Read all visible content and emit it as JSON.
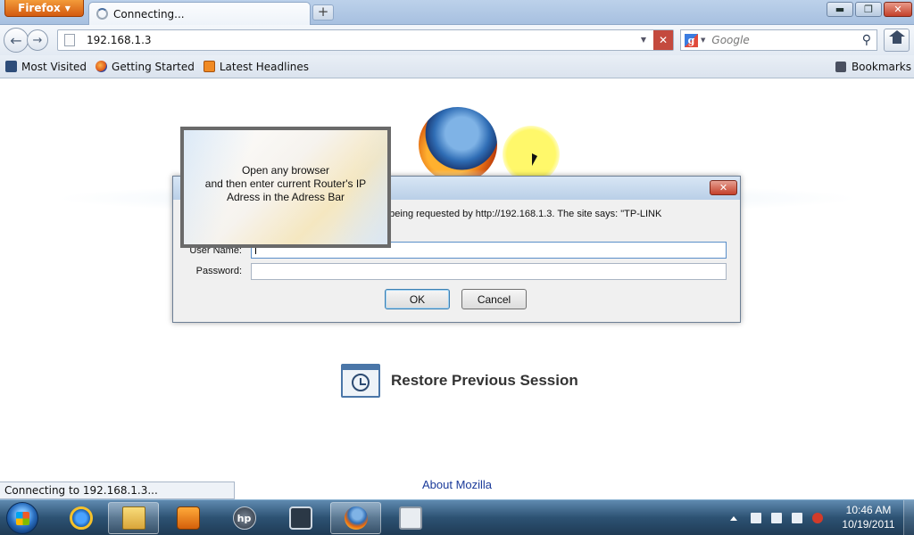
{
  "browser": {
    "menu_label": "Firefox",
    "tab_title": "Connecting...",
    "new_tab_label": "+",
    "window_buttons": {
      "minimize": "▬",
      "maximize": "❐",
      "close": "✕"
    }
  },
  "navigation": {
    "url": "192.168.1.3",
    "search_placeholder": "Google",
    "stop_label": "✕",
    "back_icon": "back-arrow-icon",
    "forward_icon": "forward-arrow-icon"
  },
  "bookmarks": {
    "items": [
      {
        "label": "Most Visited",
        "icon": "most-visited-icon"
      },
      {
        "label": "Getting Started",
        "icon": "firefox-icon"
      },
      {
        "label": "Latest Headlines",
        "icon": "rss-icon"
      }
    ],
    "menu_label": "Bookmarks"
  },
  "dialog": {
    "close_label": "✕",
    "message": "e being requested by http://192.168.1.3. The site says: \"TP-LINK",
    "username_label": "User Name:",
    "username_value": "",
    "password_label": "Password:",
    "password_value": "",
    "ok_label": "OK",
    "cancel_label": "Cancel"
  },
  "tutorial": {
    "lines": [
      "Open any browser",
      "and then enter current Router's IP",
      "Adress in the Adress Bar"
    ]
  },
  "content": {
    "restore_label": "Restore Previous Session",
    "about_label": "About Mozilla"
  },
  "status": {
    "text": "Connecting to 192.168.1.3..."
  },
  "taskbar": {
    "apps": [
      {
        "name": "Internet Explorer",
        "active": false
      },
      {
        "name": "Windows Explorer",
        "active": true
      },
      {
        "name": "Windows Media Player",
        "active": false
      },
      {
        "name": "HP",
        "active": false
      },
      {
        "name": "Camera",
        "active": false
      },
      {
        "name": "Firefox",
        "active": true
      },
      {
        "name": "Video",
        "active": false
      }
    ],
    "hp_glyph": "hp",
    "time": "10:46 AM",
    "date": "10/19/2011"
  }
}
